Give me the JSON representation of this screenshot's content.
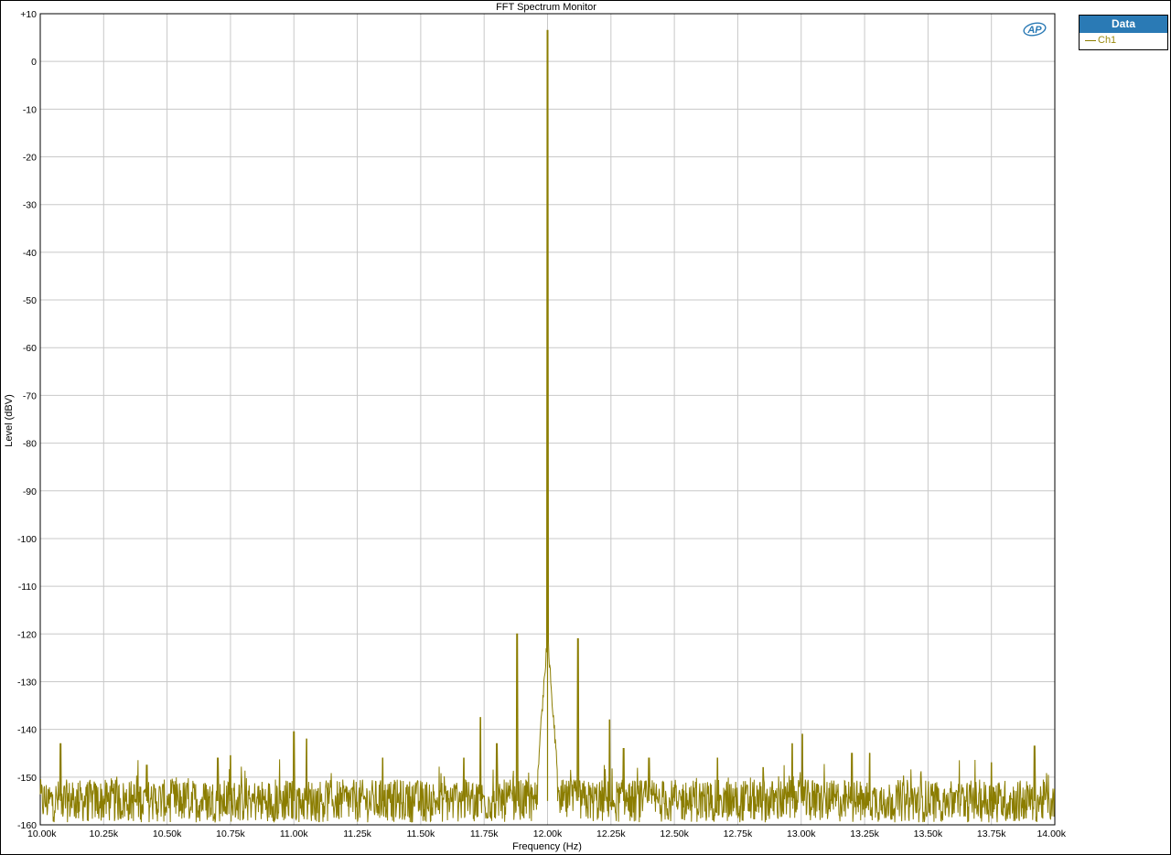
{
  "chart_data": {
    "type": "line",
    "title": "FFT Spectrum Monitor",
    "xlabel": "Frequency (Hz)",
    "ylabel": "Level (dBV)",
    "xlim": [
      10000,
      14000
    ],
    "ylim": [
      -160,
      10
    ],
    "x_ticks": [
      10000,
      10250,
      10500,
      10750,
      11000,
      11250,
      11500,
      11750,
      12000,
      12250,
      12500,
      12750,
      13000,
      13250,
      13500,
      13750,
      14000
    ],
    "x_tick_labels": [
      "10.00k",
      "10.25k",
      "10.50k",
      "10.75k",
      "11.00k",
      "11.25k",
      "11.50k",
      "11.75k",
      "12.00k",
      "12.25k",
      "12.50k",
      "12.75k",
      "13.00k",
      "13.25k",
      "13.50k",
      "13.75k",
      "14.00k"
    ],
    "y_ticks": [
      10,
      0,
      -10,
      -20,
      -30,
      -40,
      -50,
      -60,
      -70,
      -80,
      -90,
      -100,
      -110,
      -120,
      -130,
      -140,
      -150,
      -160
    ],
    "y_tick_labels": [
      "+10",
      "0",
      "-10",
      "-20",
      "-30",
      "-40",
      "-50",
      "-60",
      "-70",
      "-80",
      "-90",
      "-100",
      "-110",
      "-120",
      "-130",
      "-140",
      "-150",
      "-160"
    ],
    "grid": true,
    "legend_position": "top-right, outside plot",
    "series": [
      {
        "name": "Ch1",
        "color": "#8b7d00",
        "noise_floor_dbv": -155,
        "peaks": [
          {
            "x": 12000,
            "y": 6.5
          },
          {
            "x": 11880,
            "y": -120
          },
          {
            "x": 12120,
            "y": -121
          },
          {
            "x": 11735,
            "y": -137.5
          },
          {
            "x": 12245,
            "y": -138
          },
          {
            "x": 11000,
            "y": -140.5
          },
          {
            "x": 13005,
            "y": -141
          },
          {
            "x": 10080,
            "y": -143
          },
          {
            "x": 11050,
            "y": -142
          },
          {
            "x": 12965,
            "y": -143
          },
          {
            "x": 13920,
            "y": -143.5
          },
          {
            "x": 11800,
            "y": -143
          },
          {
            "x": 12300,
            "y": -144
          },
          {
            "x": 13200,
            "y": -145
          },
          {
            "x": 13270,
            "y": -145
          },
          {
            "x": 10700,
            "y": -146
          },
          {
            "x": 10750,
            "y": -145.5
          },
          {
            "x": 11350,
            "y": -146
          },
          {
            "x": 11670,
            "y": -146
          },
          {
            "x": 12400,
            "y": -146
          },
          {
            "x": 12670,
            "y": -146
          },
          {
            "x": 13750,
            "y": -147
          },
          {
            "x": 10420,
            "y": -147.5
          },
          {
            "x": 12850,
            "y": -148
          }
        ]
      }
    ]
  },
  "legend": {
    "header": "Data",
    "items": [
      {
        "label": "Ch1",
        "color": "#8b7d00"
      }
    ]
  },
  "logo": {
    "text": "AP"
  }
}
